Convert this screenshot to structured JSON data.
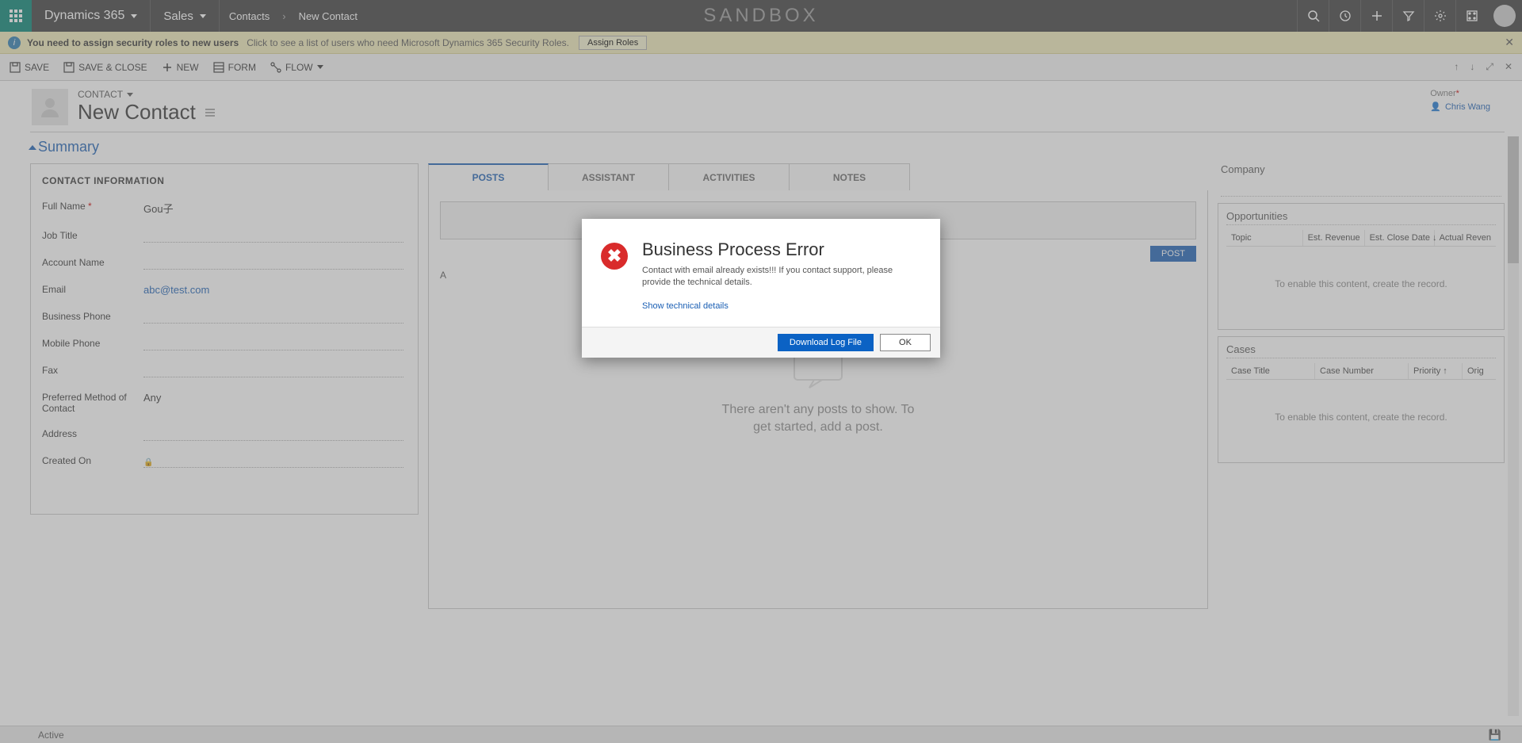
{
  "topnav": {
    "brand": "Dynamics 365",
    "area": "Sales",
    "crumb1": "Contacts",
    "crumb2": "New Contact",
    "center": "SANDBOX"
  },
  "notif": {
    "bold": "You need to assign security roles to new users",
    "sub": "Click to see a list of users who need Microsoft Dynamics 365 Security Roles.",
    "btn": "Assign Roles"
  },
  "cmdbar": {
    "save": "SAVE",
    "save_close": "SAVE & CLOSE",
    "new": "NEW",
    "form": "FORM",
    "flow": "FLOW"
  },
  "header": {
    "entity_label": "CONTACT",
    "entity_name": "New Contact",
    "owner_label": "Owner",
    "owner_value": "Chris Wang"
  },
  "section_summary": "Summary",
  "contact_info": {
    "title": "CONTACT INFORMATION",
    "full_name_label": "Full Name",
    "full_name_value": "Gou子",
    "job_title_label": "Job Title",
    "account_name_label": "Account Name",
    "email_label": "Email",
    "email_value": "abc@test.com",
    "business_phone_label": "Business Phone",
    "mobile_phone_label": "Mobile Phone",
    "fax_label": "Fax",
    "preferred_label": "Preferred Method of Contact",
    "preferred_value": "Any",
    "address_label": "Address",
    "created_on_label": "Created On"
  },
  "tabs": {
    "posts": "POSTS",
    "assistant": "ASSISTANT",
    "activities": "ACTIVITIES",
    "notes": "NOTES"
  },
  "posts_panel": {
    "post_btn": "POST",
    "filter_label": "A",
    "empty": "There aren't any posts to show. To get started, add a post."
  },
  "right": {
    "company": "Company",
    "opportunities": "Opportunities",
    "opp_cols": {
      "topic": "Topic",
      "est_rev": "Est. Revenue",
      "est_close": "Est. Close Date",
      "actual_rev": "Actual Reven"
    },
    "grid_empty": "To enable this content, create the record.",
    "cases": "Cases",
    "cases_cols": {
      "title": "Case Title",
      "number": "Case Number",
      "priority": "Priority",
      "orig": "Orig"
    }
  },
  "status": {
    "text": "Active"
  },
  "modal": {
    "title": "Business Process Error",
    "msg": "Contact with email already exists!!! If you contact support, please provide the technical details.",
    "link": "Show technical details",
    "download": "Download Log File",
    "ok": "OK"
  }
}
